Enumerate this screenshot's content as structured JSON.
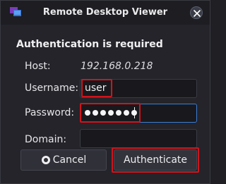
{
  "window": {
    "title": "Remote Desktop Viewer"
  },
  "dialog": {
    "heading": "Authentication is required",
    "host_label": "Host:",
    "host_value": "192.168.0.218",
    "username_label": "Username:",
    "username_value": "user",
    "password_label": "Password:",
    "password_masked_count": 7,
    "domain_label": "Domain:",
    "domain_value": ""
  },
  "buttons": {
    "cancel_label": "Cancel",
    "authenticate_label": "Authenticate"
  },
  "icons": {
    "app": "remote-desktop-icon",
    "close": "close-icon",
    "cancel": "cancel-circle-icon"
  },
  "colors": {
    "highlight": "#d0141c",
    "focus": "#3a7dd6",
    "background": "#24242a"
  }
}
